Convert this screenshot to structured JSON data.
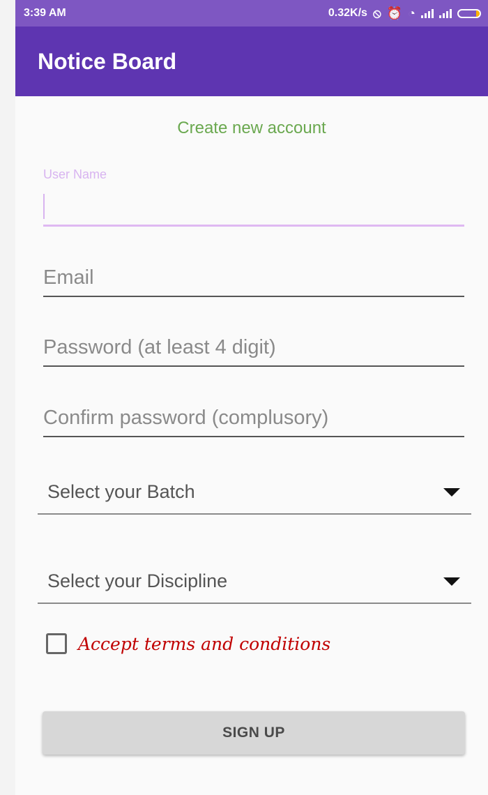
{
  "status_bar": {
    "time": "3:39 AM",
    "speed": "0.32K/s",
    "icons": [
      "notification-off-icon",
      "alarm-icon",
      "wifi-icon",
      "signal-icon",
      "signal-icon",
      "battery-icon"
    ],
    "battery_color": "#ffb300"
  },
  "app_bar": {
    "title": "Notice Board",
    "background_color": "#5e35b1",
    "status_bar_color": "#7e57c2"
  },
  "form": {
    "heading": "Create new account",
    "heading_color": "#6aa84f",
    "fields": [
      {
        "floating_label": "User Name",
        "value": "",
        "placeholder": ""
      },
      {
        "value": "",
        "placeholder": "Email"
      },
      {
        "value": "",
        "placeholder": "Password (at least 4 digit)"
      },
      {
        "value": "",
        "placeholder": "Confirm password (complusory)"
      }
    ],
    "spinners": [
      {
        "label": "Select your Batch"
      },
      {
        "label": "Select your Discipline"
      }
    ],
    "terms": {
      "checked": false,
      "label": "Accept terms and conditions",
      "label_color": "#c00000"
    },
    "submit_label": "SIGN UP"
  }
}
